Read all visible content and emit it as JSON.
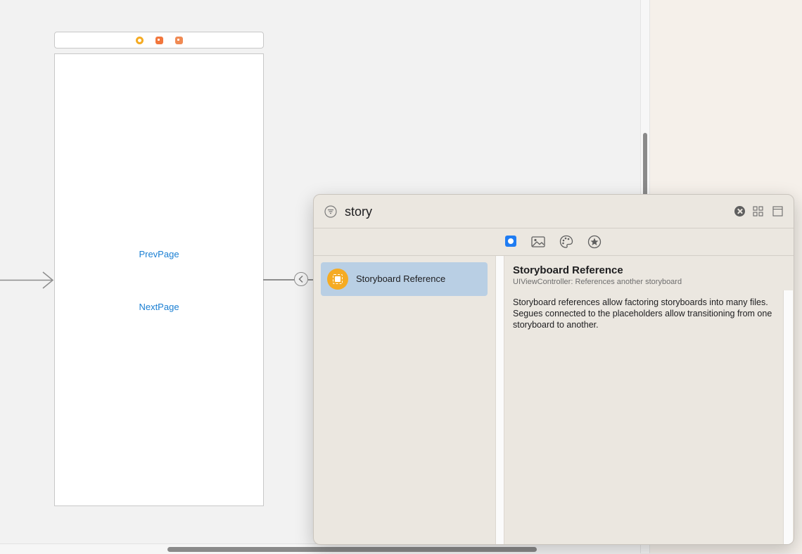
{
  "canvas": {
    "scene": {
      "dock_icons": [
        "view-controller-icon",
        "first-responder-icon",
        "exit-icon"
      ],
      "prev_link": "PrevPage",
      "next_link": "NextPage"
    }
  },
  "library": {
    "search": {
      "value": "story"
    },
    "tabs": [
      {
        "name": "objects",
        "icon": "objects-icon",
        "selected": true
      },
      {
        "name": "media",
        "icon": "image-icon",
        "selected": false
      },
      {
        "name": "colors",
        "icon": "palette-icon",
        "selected": false
      },
      {
        "name": "snippets",
        "icon": "star-icon",
        "selected": false
      }
    ],
    "results": [
      {
        "label": "Storyboard Reference",
        "icon": "storyboard-reference-icon",
        "selected": true
      }
    ],
    "detail": {
      "title": "Storyboard Reference",
      "subtitle": "UIViewController: References another storyboard",
      "description": "Storyboard references allow factoring storyboards into many files. Segues connected to the placeholders allow transitioning from one storyboard to another."
    },
    "colors": {
      "accent": "#1f7cf2",
      "selection": "#b9cfe4",
      "storyboard_icon": "#f5ab23",
      "link": "#1a7fd3"
    }
  }
}
